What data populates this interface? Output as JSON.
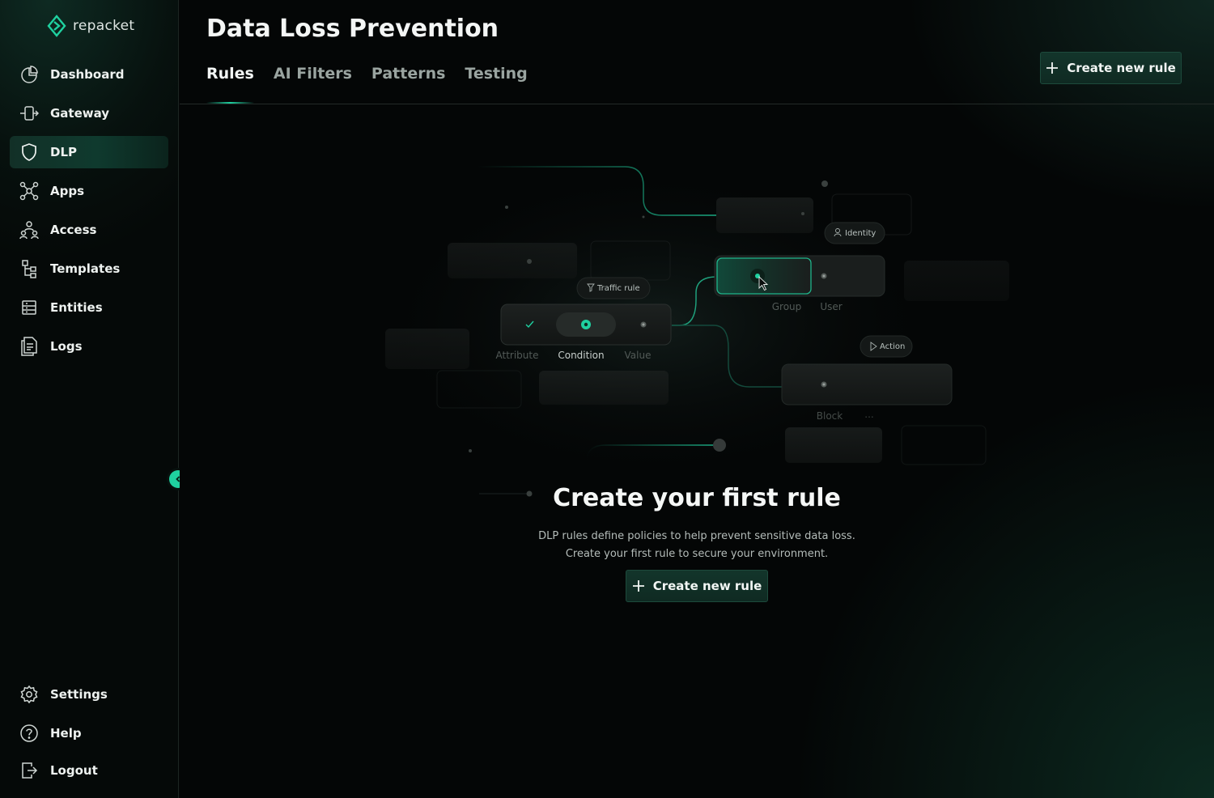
{
  "app": {
    "brand": "repacket"
  },
  "sidebar": {
    "nav": [
      {
        "label": "Dashboard",
        "icon": "dashboard-icon"
      },
      {
        "label": "Gateway",
        "icon": "gateway-icon"
      },
      {
        "label": "DLP",
        "icon": "shield-icon",
        "active": true
      },
      {
        "label": "Apps",
        "icon": "apps-icon"
      },
      {
        "label": "Access",
        "icon": "access-icon"
      },
      {
        "label": "Templates",
        "icon": "templates-icon"
      },
      {
        "label": "Entities",
        "icon": "entities-icon"
      },
      {
        "label": "Logs",
        "icon": "logs-icon"
      }
    ],
    "footer": [
      {
        "label": "Settings",
        "icon": "gear-icon"
      },
      {
        "label": "Help",
        "icon": "help-icon"
      },
      {
        "label": "Logout",
        "icon": "logout-icon"
      }
    ]
  },
  "header": {
    "title": "Data Loss Prevention",
    "tabs": [
      "Rules",
      "AI Filters",
      "Patterns",
      "Testing"
    ],
    "active_tab": "Rules",
    "create_label": "Create new rule"
  },
  "illustration": {
    "traffic_rule": "Traffic rule",
    "identity": "Identity",
    "action": "Action",
    "attribute": "Attribute",
    "condition": "Condition",
    "value": "Value",
    "group": "Group",
    "user": "User",
    "block": "Block",
    "ellipsis": "..."
  },
  "empty_state": {
    "title": "Create your first rule",
    "line1": "DLP rules define policies to help prevent sensitive data loss.",
    "line2": "Create your first rule to secure your environment.",
    "button_label": "Create new rule"
  },
  "colors": {
    "accent": "#1fd1a0",
    "accent_dark": "#0f2a22",
    "background": "#040606"
  }
}
